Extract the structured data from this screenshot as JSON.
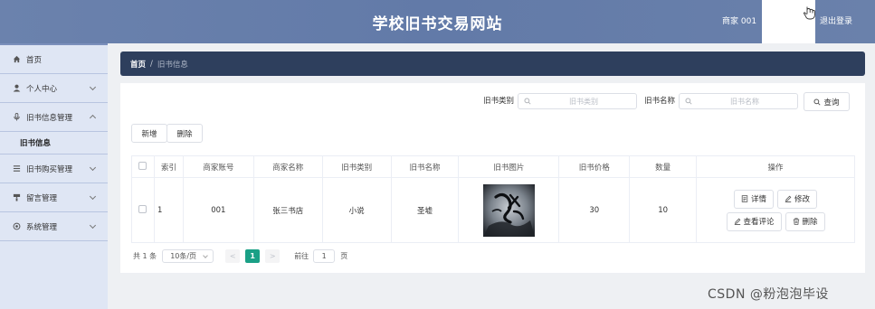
{
  "header": {
    "title": "学校旧书交易网站",
    "user_name": "商家 001",
    "logout_label": "退出登录"
  },
  "sidebar": {
    "items": [
      {
        "label": "首页",
        "icon": "home-icon"
      },
      {
        "label": "个人中心",
        "icon": "user-icon"
      },
      {
        "label": "旧书信息管理",
        "icon": "mic-icon",
        "expanded": true,
        "children": [
          {
            "label": "旧书信息"
          }
        ]
      },
      {
        "label": "旧书购买管理",
        "icon": "list-icon"
      },
      {
        "label": "留言管理",
        "icon": "message-icon"
      },
      {
        "label": "系统管理",
        "icon": "settings-icon"
      }
    ]
  },
  "breadcrumb": {
    "home": "首页",
    "separator": "/",
    "current": "旧书信息"
  },
  "search": {
    "category_label": "旧书类别",
    "category_placeholder": "旧书类别",
    "name_label": "旧书名称",
    "name_placeholder": "旧书名称",
    "button_label": "查询"
  },
  "toolbar": {
    "add_label": "新增",
    "delete_label": "删除"
  },
  "table": {
    "headers": [
      "索引",
      "商家账号",
      "商家名称",
      "旧书类别",
      "旧书名称",
      "旧书图片",
      "旧书价格",
      "数量",
      "操作"
    ],
    "rows": [
      {
        "index": "1",
        "account": "001",
        "merchant": "张三书店",
        "category": "小说",
        "name": "圣墟",
        "price": "30",
        "quantity": "10"
      }
    ],
    "actions": {
      "detail": "详情",
      "edit": "修改",
      "comments": "查看评论",
      "delete": "删除"
    }
  },
  "pagination": {
    "total": "共 1 条",
    "page_size": "10条/页",
    "prev": "<",
    "current_page": "1",
    "next": ">",
    "goto_label": "前往",
    "goto_value": "1",
    "page_suffix": "页"
  },
  "watermark": "CSDN @粉泡泡毕设",
  "colors": {
    "header_bg": "#6b82ad",
    "sidebar_bg": "#dfe6f4",
    "breadcrumb_bg": "#2e3f5d",
    "active_page": "#1aa086"
  }
}
